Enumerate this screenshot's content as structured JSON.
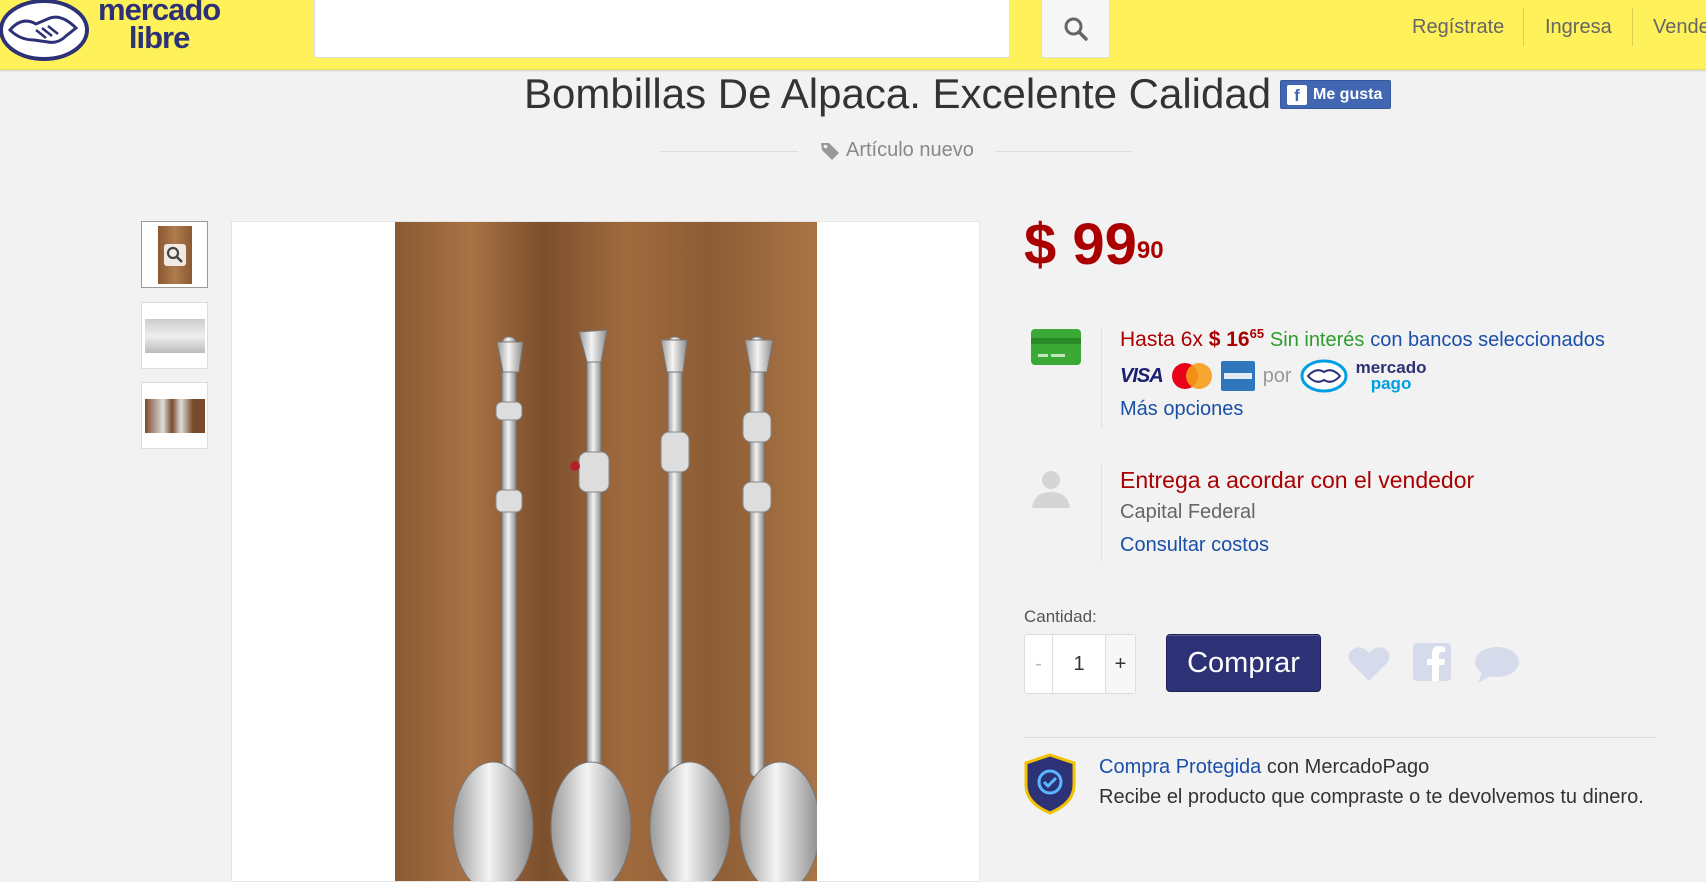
{
  "header": {
    "logo_line1": "mercado",
    "logo_line2": "libre",
    "search_placeholder": "",
    "nav": [
      "Regístrate",
      "Ingresa",
      "Vende"
    ]
  },
  "product": {
    "title": "Bombillas De Alpaca. Excelente Calidad",
    "fb_like": "Me gusta",
    "condition": "Artículo nuevo"
  },
  "price": {
    "currency": "$",
    "integer": "99",
    "cents": "90"
  },
  "installments": {
    "prefix": "Hasta 6x",
    "amount": "$ 16",
    "cents": "65",
    "no_interest": "Sin interés",
    "banks": "con bancos seleccionados",
    "card_brands": [
      "VISA",
      "MasterCard",
      "American Express"
    ],
    "via": "por",
    "mp_line1": "mercado",
    "mp_line2": "pago",
    "more_options": "Más opciones"
  },
  "shipping": {
    "title": "Entrega a acordar con el vendedor",
    "location": "Capital Federal",
    "costs_link": "Consultar costos"
  },
  "purchase": {
    "qty_label": "Cantidad:",
    "minus": "-",
    "qty_value": "1",
    "plus": "+",
    "buy_label": "Comprar"
  },
  "protection": {
    "link": "Compra Protegida",
    "suffix": "con MercadoPago",
    "description": "Recibe el producto que compraste o te devolvemos tu dinero."
  },
  "colors": {
    "header_yellow": "#fff159",
    "brand_blue": "#2d3277",
    "price_red": "#aa0000",
    "link_blue": "#1a4fa8",
    "success_green": "#2f9b2f"
  }
}
